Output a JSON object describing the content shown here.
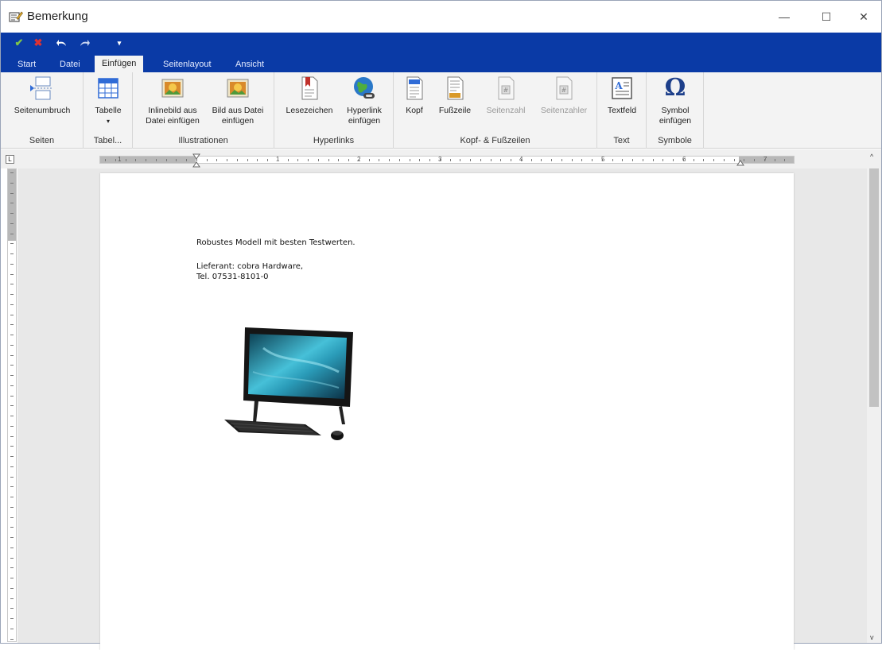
{
  "window": {
    "title": "Bemerkung",
    "controls": {
      "minimize": "—",
      "maximize": "☐",
      "close": "✕"
    }
  },
  "quick_access": {
    "icons": [
      "checkmark-icon",
      "cancel-x-icon",
      "undo-icon",
      "redo-icon",
      "dropdown-arrow-icon"
    ],
    "colors": {
      "bar": "#0a3aa6",
      "check": "#7ec44a",
      "x": "#e03131"
    }
  },
  "tabs": [
    {
      "label": "Start",
      "active": false
    },
    {
      "label": "Datei",
      "active": false
    },
    {
      "label": "Einfügen",
      "active": true
    },
    {
      "label": "Seitenlayout",
      "active": false
    },
    {
      "label": "Ansicht",
      "active": false
    }
  ],
  "ribbon": {
    "groups": {
      "seiten": {
        "name": "Seiten",
        "buttons": [
          {
            "label": "Seitenumbruch",
            "icon": "page-break-icon"
          }
        ]
      },
      "tabellen": {
        "name": "Tabel...",
        "buttons": [
          {
            "label": "Tabelle",
            "sub": "▾",
            "icon": "table-icon"
          }
        ]
      },
      "illustrationen": {
        "name": "Illustrationen",
        "buttons": [
          {
            "label1": "Inlinebild aus",
            "label2": "Datei einfügen",
            "icon": "inline-image-icon"
          },
          {
            "label1": "Bild aus Datei",
            "label2": "einfügen",
            "icon": "image-from-file-icon"
          }
        ]
      },
      "hyperlinks": {
        "name": "Hyperlinks",
        "buttons": [
          {
            "label": "Lesezeichen",
            "icon": "bookmark-icon"
          },
          {
            "label1": "Hyperlink",
            "label2": "einfügen",
            "icon": "globe-link-icon"
          }
        ]
      },
      "kopf": {
        "name": "Kopf- & Fußzeilen",
        "buttons": [
          {
            "label": "Kopf",
            "icon": "header-icon",
            "enabled": true
          },
          {
            "label": "Fußzeile",
            "icon": "footer-icon",
            "enabled": true
          },
          {
            "label": "Seitenzahl",
            "icon": "page-number-icon",
            "enabled": false
          },
          {
            "label": "Seitenzahler",
            "icon": "page-counter-icon",
            "enabled": false
          }
        ]
      },
      "text": {
        "name": "Text",
        "buttons": [
          {
            "label": "Textfeld",
            "icon": "textbox-icon"
          }
        ]
      },
      "symbole": {
        "name": "Symbole",
        "buttons": [
          {
            "label1": "Symbol",
            "label2": "einfügen",
            "icon": "omega-symbol-icon",
            "glyph": "Ω"
          }
        ]
      }
    }
  },
  "ruler": {
    "numbers": [
      "1",
      "1",
      "2",
      "3",
      "4",
      "5",
      "6",
      "7"
    ],
    "corner": "L"
  },
  "document": {
    "line1": "Robustes Modell mit besten Testwerten.",
    "line2": "Lieferant: cobra Hardware,",
    "line3": "Tel. 07531-8101-0",
    "image": "all-in-one-computer-with-keyboard-and-mouse"
  }
}
